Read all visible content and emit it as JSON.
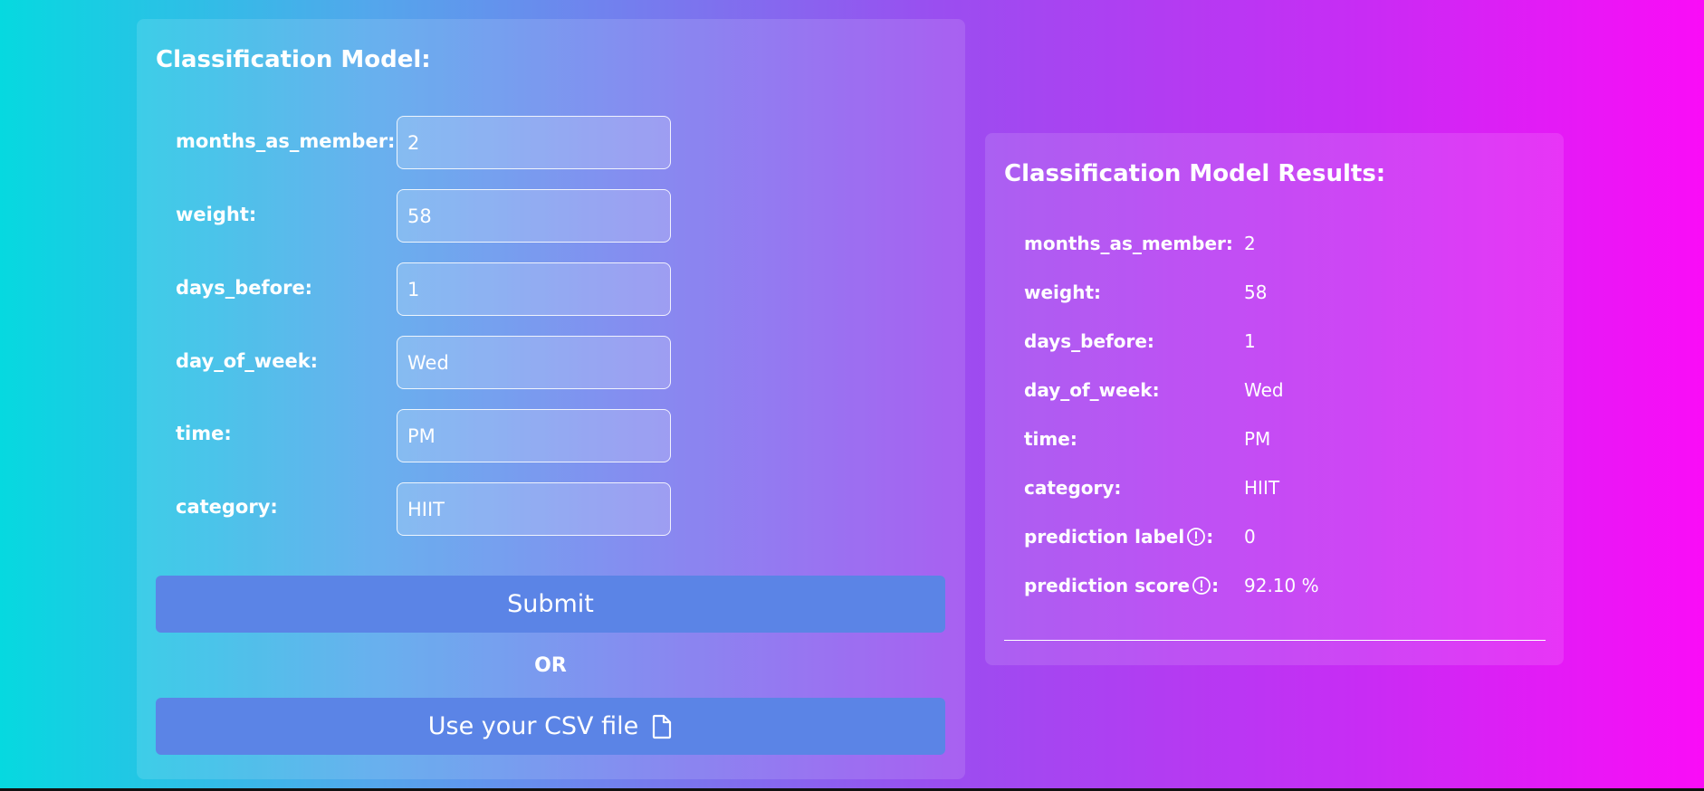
{
  "form": {
    "title": "Classification Model:",
    "fields": [
      {
        "label": "months_as_member:",
        "value": "2"
      },
      {
        "label": "weight:",
        "value": "58"
      },
      {
        "label": "days_before:",
        "value": "1"
      },
      {
        "label": "day_of_week:",
        "value": "Wed"
      },
      {
        "label": "time:",
        "value": "PM"
      },
      {
        "label": "category:",
        "value": "HIIT"
      }
    ],
    "submit_label": "Submit",
    "or_text": "OR",
    "csv_label": "Use your CSV file",
    "csv_icon": "file-icon"
  },
  "results": {
    "title": "Classification Model Results:",
    "rows": [
      {
        "label": "months_as_member:",
        "value": "2"
      },
      {
        "label": "weight:",
        "value": "58"
      },
      {
        "label": "days_before:",
        "value": "1"
      },
      {
        "label": "day_of_week:",
        "value": "Wed"
      },
      {
        "label": "time:",
        "value": "PM"
      },
      {
        "label": "category:",
        "value": "HIIT"
      },
      {
        "label": "prediction label",
        "suffix": ":",
        "value": "0",
        "icon": "info-icon"
      },
      {
        "label": "prediction score",
        "suffix": ":",
        "value": "92.10 %",
        "icon": "info-icon"
      }
    ]
  },
  "colors": {
    "gradient_start": "#06d9e0",
    "gradient_end": "#fa0cf7",
    "button": "#5b84e6",
    "text": "#ffffff"
  }
}
